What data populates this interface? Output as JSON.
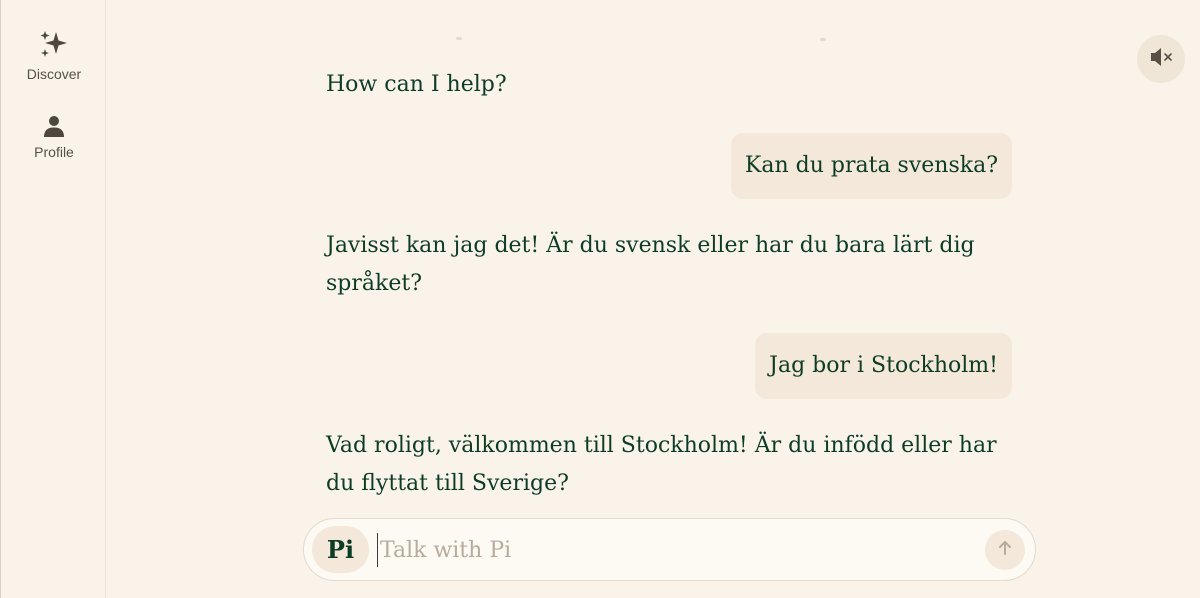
{
  "sidebar": {
    "items": [
      {
        "label": "Discover",
        "icon": "sparkles-icon"
      },
      {
        "label": "Profile",
        "icon": "person-icon"
      }
    ]
  },
  "header": {
    "mute_icon": "speaker-muted-icon"
  },
  "conversation": {
    "messages": [
      {
        "role": "assistant",
        "text": "How can I help?"
      },
      {
        "role": "user",
        "text": "Kan du prata svenska?"
      },
      {
        "role": "assistant",
        "text": "Javisst kan jag det! Är du svensk eller har du bara lärt dig språket?"
      },
      {
        "role": "user",
        "text": "Jag bor i Stockholm!"
      },
      {
        "role": "assistant",
        "text": "Vad roligt, välkommen till Stockholm! Är du infödd eller har du flyttat till Sverige?"
      }
    ]
  },
  "composer": {
    "badge": "Pi",
    "placeholder": "Talk with Pi",
    "value": "",
    "send_icon": "arrow-up-icon"
  },
  "colors": {
    "background": "#faf3ea",
    "text": "#0d3c26",
    "bubble": "#f3e8d9",
    "muted": "#5a4f45"
  }
}
